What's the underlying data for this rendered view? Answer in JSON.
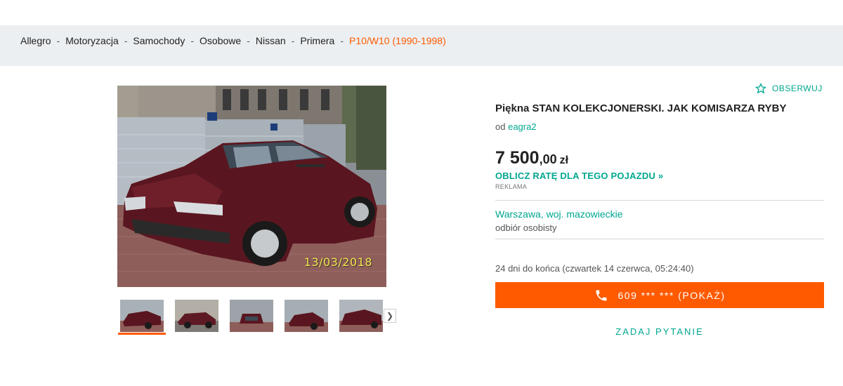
{
  "breadcrumb": {
    "items": [
      "Allegro",
      "Motoryzacja",
      "Samochody",
      "Osobowe",
      "Nissan",
      "Primera"
    ],
    "separator": "-",
    "current": "P10/W10 (1990-1998)"
  },
  "gallery": {
    "photo_date": "13/03/2018",
    "next_icon": "chevron-right-icon"
  },
  "offer": {
    "watch_label": "OBSERWUJ",
    "title": "Piękna STAN KOLEKCJONERSKI. JAK KOMISARZA RYBY",
    "seller_prefix": "od",
    "seller_name": "eagra2",
    "price_main": "7 500",
    "price_decimal": ",00",
    "price_currency": "zł",
    "rate_link": "OBLICZ RATĘ DLA TEGO POJAZDU »",
    "ad_label": "REKLAMA",
    "location": "Warszawa, woj. mazowieckie",
    "pickup": "odbiór osobisty",
    "time_left": "24 dni do końca (czwartek 14 czerwca, 05:24:40)",
    "phone_button": "609 *** *** (POKAŻ)",
    "ask_button": "ZADAJ PYTANIE"
  },
  "colors": {
    "accent_orange": "#ff5a00",
    "accent_teal": "#00a790",
    "breadcrumb_bg": "#eceff1"
  }
}
